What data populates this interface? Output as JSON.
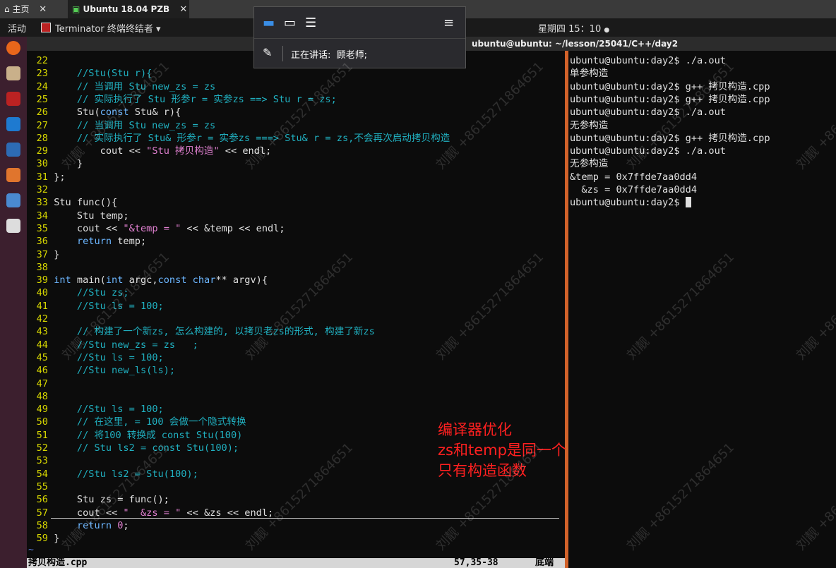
{
  "host_tabs": {
    "home": "主页",
    "vm": "Ubuntu 18.04 PZB"
  },
  "top_panel": {
    "activities": "活动",
    "app_menu": "Terminator 终端终结者 ▾",
    "clock": "星期四 15：10"
  },
  "window_title": "ubuntu@ubuntu: ~/lesson/25041/C++/day2",
  "meeting": {
    "speaking_label": "正在讲话:",
    "speaker": "顾老师;"
  },
  "editor": {
    "lines": [
      {
        "n": "22",
        "segs": [
          {
            "t": "",
            "c": "code"
          }
        ]
      },
      {
        "n": "23",
        "segs": [
          {
            "t": "    //Stu(Stu r){",
            "c": "comment"
          }
        ]
      },
      {
        "n": "24",
        "segs": [
          {
            "t": "    // 当调用 Stu new_zs = zs",
            "c": "comment"
          }
        ]
      },
      {
        "n": "25",
        "segs": [
          {
            "t": "    // 实际执行了 Stu 形参r = 实参zs ==> Stu r = zs;",
            "c": "comment"
          }
        ]
      },
      {
        "n": "26",
        "segs": [
          {
            "t": "    Stu(",
            "c": "code"
          },
          {
            "t": "const",
            "c": "kw"
          },
          {
            "t": " Stu& r){",
            "c": "code"
          }
        ]
      },
      {
        "n": "27",
        "segs": [
          {
            "t": "    // 当调用 Stu new_zs = zs",
            "c": "comment"
          }
        ]
      },
      {
        "n": "28",
        "segs": [
          {
            "t": "    // 实际执行了 Stu& 形参r = 实参zs ===> Stu& r = zs,不会再次启动拷贝构造",
            "c": "comment"
          }
        ]
      },
      {
        "n": "29",
        "segs": [
          {
            "t": "        cout << ",
            "c": "code"
          },
          {
            "t": "\"Stu 拷贝构造\"",
            "c": "str"
          },
          {
            "t": " << endl;",
            "c": "code"
          }
        ]
      },
      {
        "n": "30",
        "segs": [
          {
            "t": "    }",
            "c": "code"
          }
        ]
      },
      {
        "n": "31",
        "segs": [
          {
            "t": "};",
            "c": "code"
          }
        ]
      },
      {
        "n": "32",
        "segs": [
          {
            "t": "",
            "c": "code"
          }
        ]
      },
      {
        "n": "33",
        "segs": [
          {
            "t": "Stu func(){",
            "c": "code"
          }
        ]
      },
      {
        "n": "34",
        "segs": [
          {
            "t": "    Stu temp;",
            "c": "code"
          }
        ]
      },
      {
        "n": "35",
        "segs": [
          {
            "t": "    cout << ",
            "c": "code"
          },
          {
            "t": "\"&temp = \"",
            "c": "str"
          },
          {
            "t": " << &temp << endl;",
            "c": "code"
          }
        ]
      },
      {
        "n": "36",
        "segs": [
          {
            "t": "    ",
            "c": "code"
          },
          {
            "t": "return",
            "c": "kw"
          },
          {
            "t": " temp;",
            "c": "code"
          }
        ]
      },
      {
        "n": "37",
        "segs": [
          {
            "t": "}",
            "c": "code"
          }
        ]
      },
      {
        "n": "38",
        "segs": [
          {
            "t": "",
            "c": "code"
          }
        ]
      },
      {
        "n": "39",
        "segs": [
          {
            "t": "int",
            "c": "kw"
          },
          {
            "t": " main(",
            "c": "code"
          },
          {
            "t": "int",
            "c": "kw"
          },
          {
            "t": " argc,",
            "c": "code"
          },
          {
            "t": "const char",
            "c": "kw"
          },
          {
            "t": "** argv){",
            "c": "code"
          }
        ]
      },
      {
        "n": "40",
        "segs": [
          {
            "t": "    //Stu zs;",
            "c": "comment"
          }
        ]
      },
      {
        "n": "41",
        "segs": [
          {
            "t": "    //Stu ls = 100;",
            "c": "comment"
          }
        ]
      },
      {
        "n": "42",
        "segs": [
          {
            "t": "",
            "c": "code"
          }
        ]
      },
      {
        "n": "43",
        "segs": [
          {
            "t": "    // 构建了一个新zs, 怎么构建的, 以拷贝老zs的形式, 构建了新zs",
            "c": "comment"
          }
        ]
      },
      {
        "n": "44",
        "segs": [
          {
            "t": "    //Stu new_zs = zs   ;",
            "c": "comment"
          }
        ]
      },
      {
        "n": "45",
        "segs": [
          {
            "t": "    //Stu ls = 100;",
            "c": "comment"
          }
        ]
      },
      {
        "n": "46",
        "segs": [
          {
            "t": "    //Stu new_ls(ls);",
            "c": "comment"
          }
        ]
      },
      {
        "n": "47",
        "segs": [
          {
            "t": "",
            "c": "code"
          }
        ]
      },
      {
        "n": "48",
        "segs": [
          {
            "t": "",
            "c": "code"
          }
        ]
      },
      {
        "n": "49",
        "segs": [
          {
            "t": "    //Stu ls = 100;",
            "c": "comment"
          }
        ]
      },
      {
        "n": "50",
        "segs": [
          {
            "t": "    // 在这里, = 100 会做一个隐式转换",
            "c": "comment"
          }
        ]
      },
      {
        "n": "51",
        "segs": [
          {
            "t": "    // 将100 转换成 const Stu(100)",
            "c": "comment"
          }
        ]
      },
      {
        "n": "52",
        "segs": [
          {
            "t": "    // Stu ls2 = const Stu(100);",
            "c": "comment"
          }
        ]
      },
      {
        "n": "53",
        "segs": [
          {
            "t": "",
            "c": "code"
          }
        ]
      },
      {
        "n": "54",
        "segs": [
          {
            "t": "    //Stu ls2 = Stu(100);",
            "c": "comment"
          }
        ]
      },
      {
        "n": "55",
        "segs": [
          {
            "t": "",
            "c": "code"
          }
        ]
      },
      {
        "n": "56",
        "segs": [
          {
            "t": "    Stu zs = func();",
            "c": "code"
          }
        ]
      },
      {
        "n": "57",
        "segs": [
          {
            "t": "    cout << ",
            "c": "code"
          },
          {
            "t": "\"  &zs = \"",
            "c": "str"
          },
          {
            "t": " << &zs << endl;",
            "c": "code"
          }
        ]
      },
      {
        "n": "58",
        "segs": [
          {
            "t": "    ",
            "c": "code"
          },
          {
            "t": "return",
            "c": "kw"
          },
          {
            "t": " ",
            "c": "code"
          },
          {
            "t": "0",
            "c": "num"
          },
          {
            "t": ";",
            "c": "code"
          }
        ]
      },
      {
        "n": "59",
        "segs": [
          {
            "t": "}",
            "c": "code"
          }
        ]
      }
    ],
    "tilde": "~",
    "status_file": "拷贝构造.cpp",
    "status_pos": "57,35-38",
    "status_end": "底端"
  },
  "terminal": {
    "lines": [
      "ubuntu@ubuntu:day2$ ./a.out",
      "单参构造",
      "ubuntu@ubuntu:day2$ g++ 拷贝构造.cpp",
      "ubuntu@ubuntu:day2$ g++ 拷贝构造.cpp",
      "ubuntu@ubuntu:day2$ ./a.out",
      "无参构造",
      "ubuntu@ubuntu:day2$ g++ 拷贝构造.cpp",
      "ubuntu@ubuntu:day2$ ./a.out",
      "无参构造",
      "&temp = 0x7ffde7aa0dd4",
      "  &zs = 0x7ffde7aa0dd4",
      "ubuntu@ubuntu:day2$ "
    ]
  },
  "annotation": [
    "编译器优化",
    "zs和temp是同一个",
    "只有构造函数"
  ],
  "watermark": "刘靓 +8615271864651",
  "colors": {
    "divider": "#d2622a",
    "annotation": "#ff2020",
    "line_numbers": "#d7d700",
    "comment": "#20b0c0"
  }
}
